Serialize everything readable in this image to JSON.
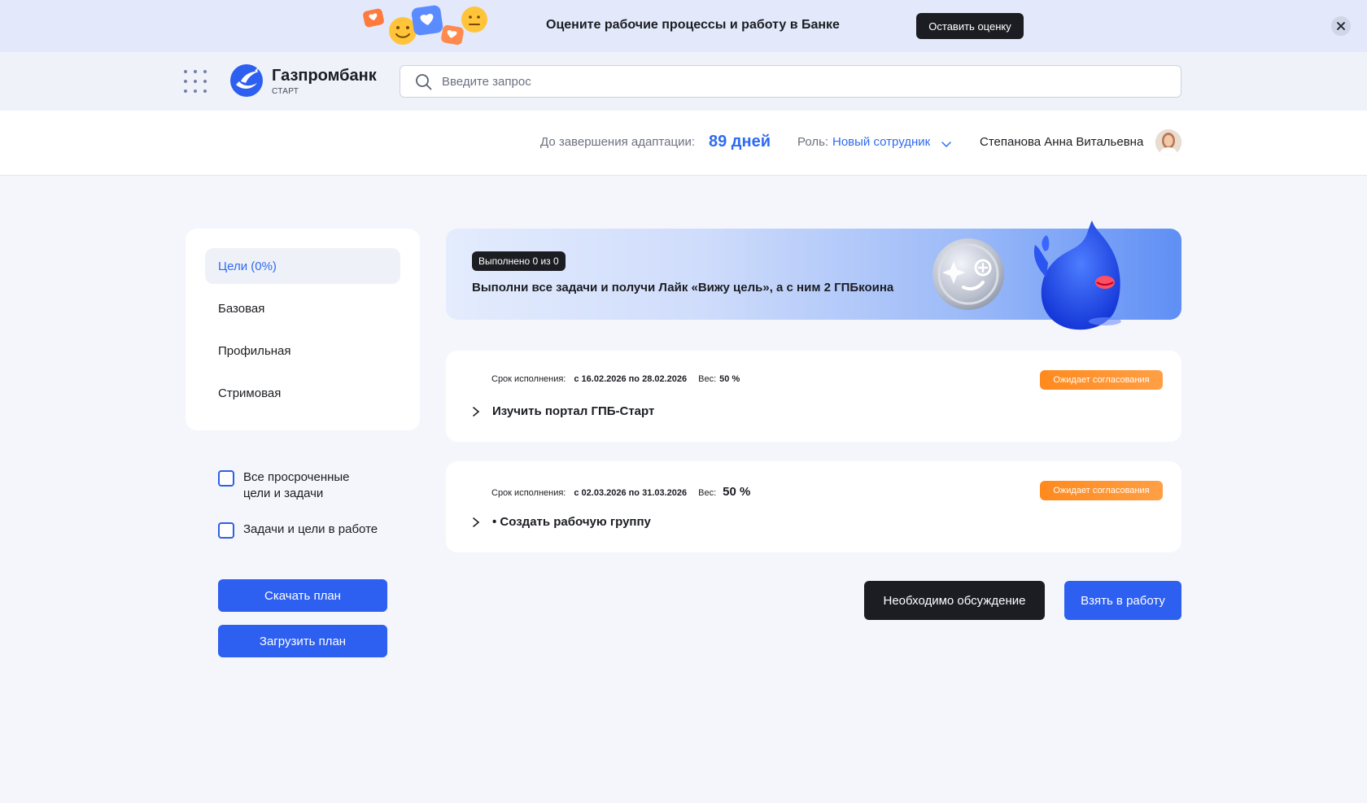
{
  "promo": {
    "text": "Оцените рабочие процессы и работу в Банке",
    "button": "Оставить оценку"
  },
  "brand": {
    "name": "Газпромбанк",
    "sub": "СТАРТ"
  },
  "search": {
    "placeholder": "Введите запрос"
  },
  "status": {
    "adapt_label": "До завершения адаптации:",
    "adapt_value": "89 дней",
    "role_label": "Роль:",
    "role_value": "Новый сотрудник",
    "user_name": "Степанова Анна Витальевна"
  },
  "sidebar": {
    "items": [
      {
        "label": "Цели (0%)"
      },
      {
        "label": "Базовая"
      },
      {
        "label": "Профильная"
      },
      {
        "label": "Стримовая"
      }
    ]
  },
  "filters": {
    "overdue": "Все просроченные\nцели и задачи",
    "in_work": "Задачи и цели в работе"
  },
  "plan_buttons": {
    "download": "Скачать план",
    "upload": "Загрузить план"
  },
  "reward": {
    "badge": "Выполнено 0 из 0",
    "text": "Выполни все задачи и получи Лайк «Вижу цель», а с ним 2 ГПБкоина"
  },
  "tasks": [
    {
      "deadline_label": "Срок исполнения:",
      "deadline": "с 16.02.2026 по 28.02.2026",
      "weight_label": "Вес:",
      "weight": "50 %",
      "status": "Ожидает согласования",
      "title": "Изучить портал ГПБ-Старт"
    },
    {
      "deadline_label": "Срок исполнения:",
      "deadline": "с 02.03.2026 по 31.03.2026",
      "weight_label": "Вес:",
      "weight": "50 %",
      "status": "Ожидает согласования",
      "title": "• Создать рабочую группу"
    }
  ],
  "actions": {
    "discuss": "Необходимо обсуждение",
    "take": "Взять в работу"
  },
  "colors": {
    "accent": "#2d5ff0",
    "accent_text": "#2f6bf0",
    "dark": "#1b1d22",
    "status_orange": "#ff8a1e"
  }
}
